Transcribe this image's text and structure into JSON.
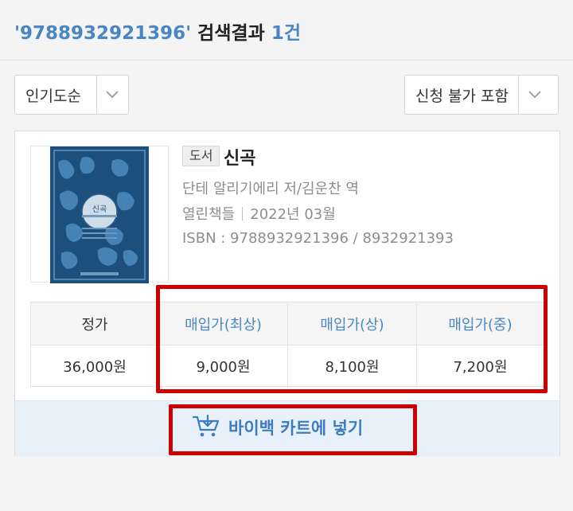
{
  "header": {
    "query": "'9788932921396'",
    "results_label": "검색결과",
    "count": "1건"
  },
  "sort": {
    "label": "인기도순"
  },
  "filter": {
    "label": "신청 불가 포함"
  },
  "book": {
    "type_badge": "도서",
    "title": "신곡",
    "author": "단테 알리기에리 저/김운찬 역",
    "publisher": "열린책들",
    "date": "2022년 03월",
    "isbn": "ISBN : 9788932921396 / 8932921393",
    "cover_title": "신곡"
  },
  "prices": {
    "headers": [
      "정가",
      "매입가(최상)",
      "매입가(상)",
      "매입가(중)"
    ],
    "values": [
      "36,000원",
      "9,000원",
      "8,100원",
      "7,200원"
    ]
  },
  "cart": {
    "button_label": "바이백 카트에 넣기"
  },
  "colors": {
    "accent": "#4a86c4",
    "highlight": "#cc0000",
    "cover": "#1d4f7c"
  }
}
